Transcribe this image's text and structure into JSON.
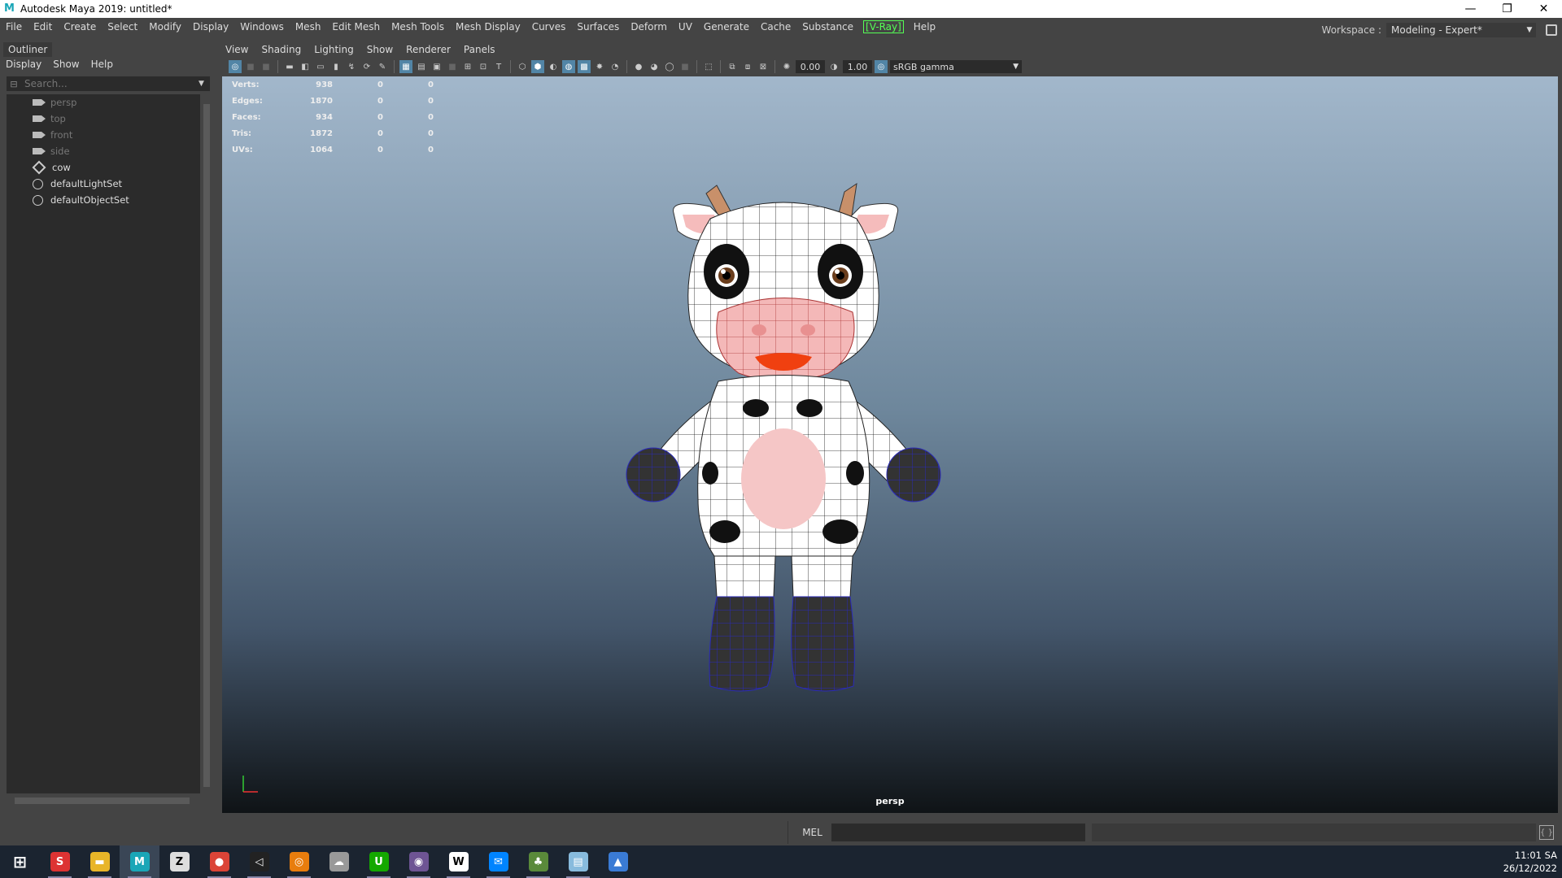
{
  "window": {
    "title": "Autodesk Maya 2019: untitled*",
    "minimize": "—",
    "restore": "❐",
    "close": "✕"
  },
  "menubar": [
    "File",
    "Edit",
    "Create",
    "Select",
    "Modify",
    "Display",
    "Windows",
    "Mesh",
    "Edit Mesh",
    "Mesh Tools",
    "Mesh Display",
    "Curves",
    "Surfaces",
    "Deform",
    "UV",
    "Generate",
    "Cache",
    "Substance",
    "[V-Ray]",
    "Help"
  ],
  "workspace": {
    "label": "Workspace :",
    "value": "Modeling - Expert*"
  },
  "outliner": {
    "tab": "Outliner",
    "menu": [
      "Display",
      "Show",
      "Help"
    ],
    "search_placeholder": "Search...",
    "items": [
      {
        "label": "persp",
        "icon": "camera-icon",
        "dim": true
      },
      {
        "label": "top",
        "icon": "camera-icon",
        "dim": true
      },
      {
        "label": "front",
        "icon": "camera-icon",
        "dim": true
      },
      {
        "label": "side",
        "icon": "camera-icon",
        "dim": true
      },
      {
        "label": "cow",
        "icon": "mesh-icon",
        "dim": false
      },
      {
        "label": "defaultLightSet",
        "icon": "set-icon",
        "dim": false
      },
      {
        "label": "defaultObjectSet",
        "icon": "set-icon",
        "dim": false
      }
    ]
  },
  "viewport": {
    "menu": [
      "View",
      "Shading",
      "Lighting",
      "Show",
      "Renderer",
      "Panels"
    ],
    "exposure": "0.00",
    "gamma": "1.00",
    "color_space": "sRGB gamma",
    "camera": "persp",
    "hud": [
      {
        "label": "Verts:",
        "v1": "938",
        "v2": "0",
        "v3": "0"
      },
      {
        "label": "Edges:",
        "v1": "1870",
        "v2": "0",
        "v3": "0"
      },
      {
        "label": "Faces:",
        "v1": "934",
        "v2": "0",
        "v3": "0"
      },
      {
        "label": "Tris:",
        "v1": "1872",
        "v2": "0",
        "v3": "0"
      },
      {
        "label": "UVs:",
        "v1": "1064",
        "v2": "0",
        "v3": "0"
      }
    ]
  },
  "commandline": {
    "mode": "MEL"
  },
  "taskbar": {
    "time": "11:01 SA",
    "date": "26/12/2022",
    "apps": [
      {
        "name": "start-icon",
        "color": "#1b2430",
        "glyph": "⊞"
      },
      {
        "name": "substance-icon",
        "color": "#d33",
        "glyph": "S"
      },
      {
        "name": "file-explorer-icon",
        "color": "#e8b528",
        "glyph": "▬"
      },
      {
        "name": "maya-icon",
        "color": "#1aa6b7",
        "glyph": "M"
      },
      {
        "name": "zbrush-icon",
        "color": "#ddd",
        "glyph": "Z"
      },
      {
        "name": "chrome-icon",
        "color": "#db4437",
        "glyph": "●"
      },
      {
        "name": "unity-icon",
        "color": "#222",
        "glyph": "◁"
      },
      {
        "name": "blender-icon",
        "color": "#e87d0d",
        "glyph": "◎"
      },
      {
        "name": "marvelous-icon",
        "color": "#999",
        "glyph": "☁"
      },
      {
        "name": "upwork-icon",
        "color": "#14a800",
        "glyph": "U"
      },
      {
        "name": "github-icon",
        "color": "#6e5494",
        "glyph": "◉"
      },
      {
        "name": "webstorm-icon",
        "color": "#fff",
        "glyph": "W"
      },
      {
        "name": "messenger-icon",
        "color": "#0084ff",
        "glyph": "✉"
      },
      {
        "name": "speedtree-icon",
        "color": "#5a8a3a",
        "glyph": "♣"
      },
      {
        "name": "notepad-icon",
        "color": "#8bd",
        "glyph": "▤"
      },
      {
        "name": "photos-icon",
        "color": "#3a7bd5",
        "glyph": "▲"
      }
    ]
  }
}
